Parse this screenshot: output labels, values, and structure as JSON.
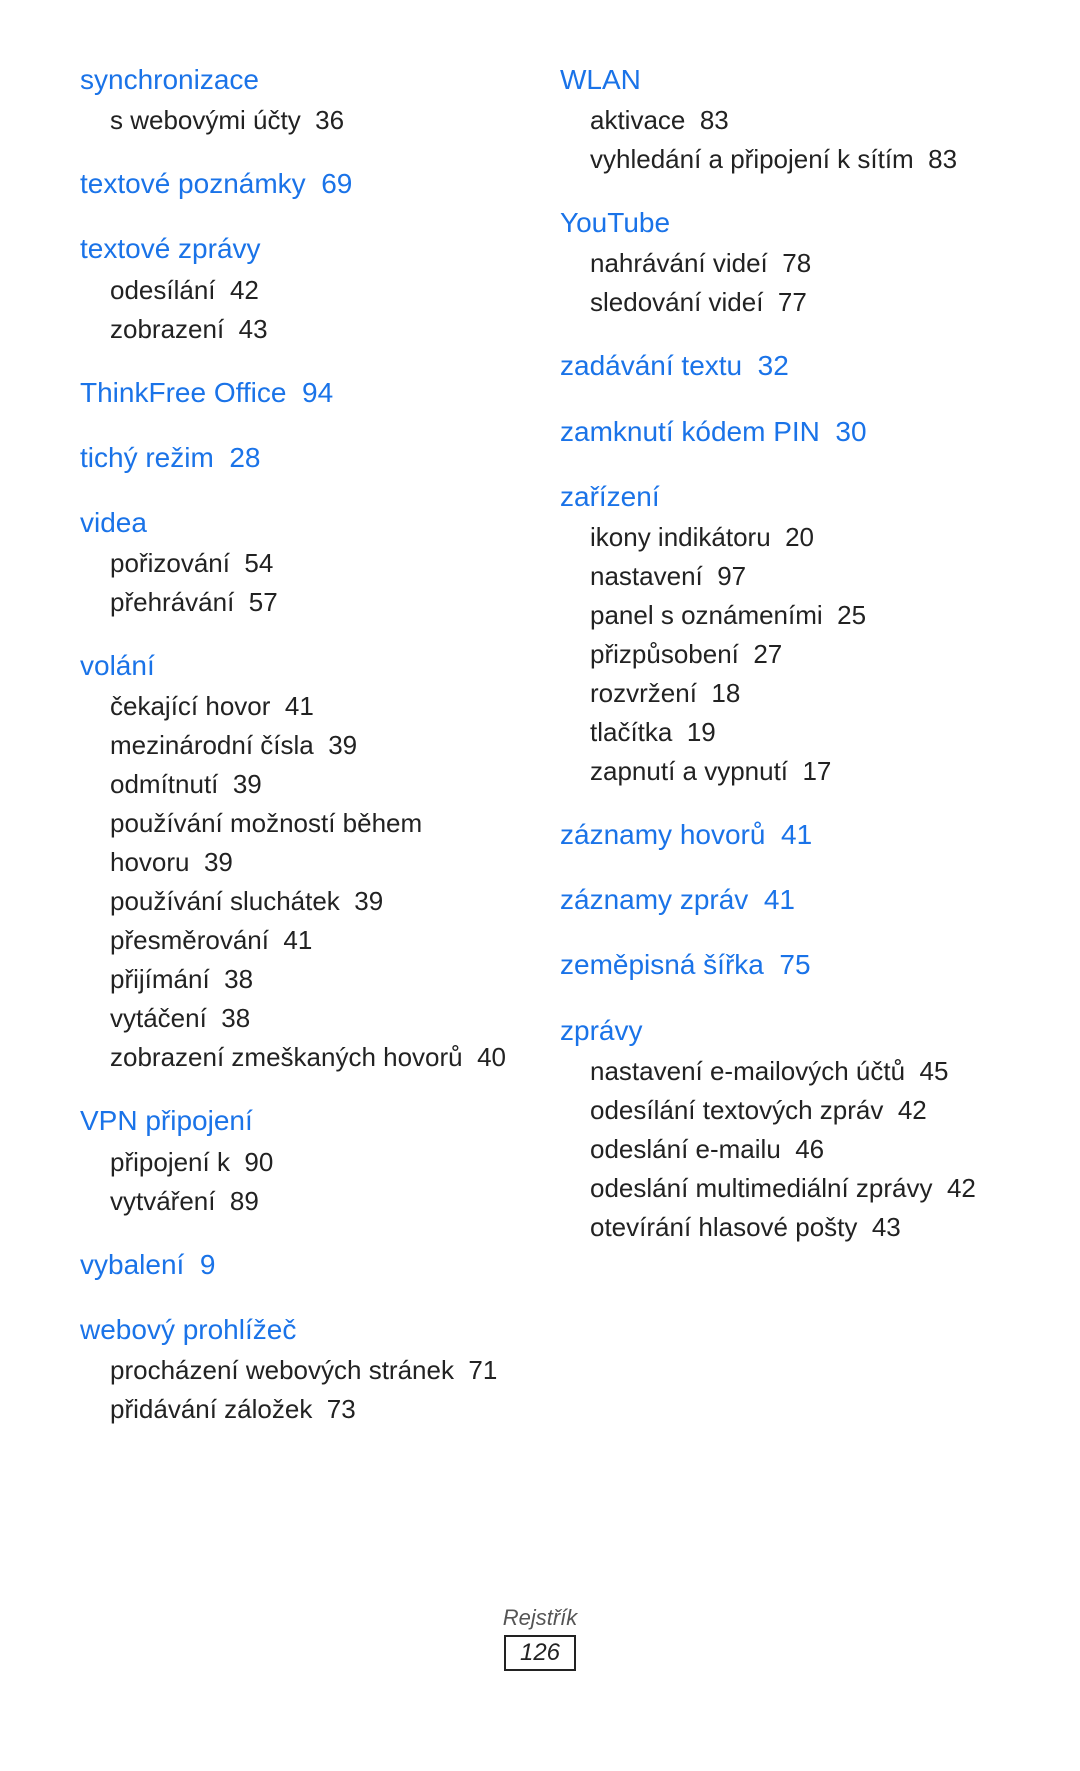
{
  "columns": [
    {
      "entries": [
        {
          "heading": "synchronizace",
          "headingPage": null,
          "subitems": [
            {
              "text": "s webovými účty",
              "page": "36"
            }
          ]
        },
        {
          "heading": "textové poznámky",
          "headingPage": "69",
          "subitems": []
        },
        {
          "heading": "textové zprávy",
          "headingPage": null,
          "subitems": [
            {
              "text": "odesílání",
              "page": "42"
            },
            {
              "text": "zobrazení",
              "page": "43"
            }
          ]
        },
        {
          "heading": "ThinkFree Office",
          "headingPage": "94",
          "subitems": []
        },
        {
          "heading": "tichý režim",
          "headingPage": "28",
          "subitems": []
        },
        {
          "heading": "videa",
          "headingPage": null,
          "subitems": [
            {
              "text": "pořizování",
              "page": "54"
            },
            {
              "text": "přehrávání",
              "page": "57"
            }
          ]
        },
        {
          "heading": "volání",
          "headingPage": null,
          "subitems": [
            {
              "text": "čekající hovor",
              "page": "41"
            },
            {
              "text": "mezinárodní čísla",
              "page": "39"
            },
            {
              "text": "odmítnutí",
              "page": "39"
            },
            {
              "text": "používání možností během hovoru",
              "page": "39"
            },
            {
              "text": "používání sluchátek",
              "page": "39"
            },
            {
              "text": "přesměrování",
              "page": "41"
            },
            {
              "text": "přijímání",
              "page": "38"
            },
            {
              "text": "vytáčení",
              "page": "38"
            },
            {
              "text": "zobrazení zmeškaných hovorů",
              "page": "40"
            }
          ]
        },
        {
          "heading": "VPN připojení",
          "headingPage": null,
          "subitems": [
            {
              "text": "připojení k",
              "page": "90"
            },
            {
              "text": "vytváření",
              "page": "89"
            }
          ]
        },
        {
          "heading": "vybalení",
          "headingPage": "9",
          "subitems": []
        },
        {
          "heading": "webový prohlížeč",
          "headingPage": null,
          "subitems": [
            {
              "text": "procházení webových stránek",
              "page": "71"
            },
            {
              "text": "přidávání záložek",
              "page": "73"
            }
          ]
        }
      ]
    },
    {
      "entries": [
        {
          "heading": "WLAN",
          "headingPage": null,
          "subitems": [
            {
              "text": "aktivace",
              "page": "83"
            },
            {
              "text": "vyhledání a připojení k sítím",
              "page": "83"
            }
          ]
        },
        {
          "heading": "YouTube",
          "headingPage": null,
          "subitems": [
            {
              "text": "nahrávání videí",
              "page": "78"
            },
            {
              "text": "sledování videí",
              "page": "77"
            }
          ]
        },
        {
          "heading": "zadávání textu",
          "headingPage": "32",
          "subitems": []
        },
        {
          "heading": "zamknutí kódem PIN",
          "headingPage": "30",
          "subitems": []
        },
        {
          "heading": "zařízení",
          "headingPage": null,
          "subitems": [
            {
              "text": "ikony indikátoru",
              "page": "20"
            },
            {
              "text": "nastavení",
              "page": "97"
            },
            {
              "text": "panel s oznámeními",
              "page": "25"
            },
            {
              "text": "přizpůsobení",
              "page": "27"
            },
            {
              "text": "rozvržení",
              "page": "18"
            },
            {
              "text": "tlačítka",
              "page": "19"
            },
            {
              "text": "zapnutí a vypnutí",
              "page": "17"
            }
          ]
        },
        {
          "heading": "záznamy hovorů",
          "headingPage": "41",
          "subitems": []
        },
        {
          "heading": "záznamy zpráv",
          "headingPage": "41",
          "subitems": []
        },
        {
          "heading": "zeměpisná šířka",
          "headingPage": "75",
          "subitems": []
        },
        {
          "heading": "zprávy",
          "headingPage": null,
          "subitems": [
            {
              "text": "nastavení e-mailových účtů",
              "page": "45"
            },
            {
              "text": "odesílání textových zpráv",
              "page": "42"
            },
            {
              "text": "odeslání e-mailu",
              "page": "46"
            },
            {
              "text": "odeslání multimediální zprávy",
              "page": "42"
            },
            {
              "text": "otevírání hlasové pošty",
              "page": "43"
            }
          ]
        }
      ]
    }
  ],
  "footer": {
    "label": "Rejstřík",
    "page": "126"
  }
}
